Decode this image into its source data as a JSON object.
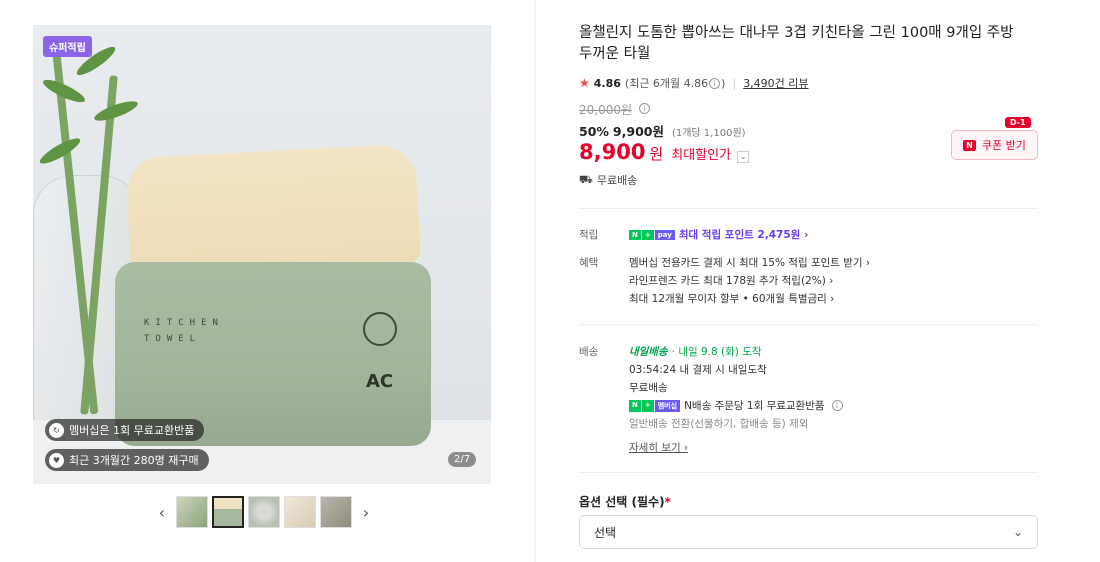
{
  "gallery": {
    "badge_top": "슈퍼적립",
    "pill_exchange": "멤버십은 1회 무료교환반품",
    "pill_repurchase": "최근 3개월간 280명 재구매",
    "counter": "2/7",
    "box_line1": "KITCHEN",
    "box_line2": "TOWEL",
    "box_logo": "AC",
    "prev_icon": "‹",
    "next_icon": "›"
  },
  "product": {
    "title": "올챌린지 도톰한 뽑아쓰는 대나무 3겹 키친타올 그린 100매 9개입 주방 두꺼운 타월",
    "rating": "4.86",
    "rating_recent": "(최근 6개월 4.86",
    "rating_recent_close": ")",
    "reviews": "3,490건 리뷰",
    "original_price": "20,000원",
    "discount_rate": "50%",
    "sale_price": "9,900원",
    "per_unit": "(1개당 1,100원)",
    "final_price": "8,900",
    "final_currency": "원",
    "final_label": "최대할인가",
    "free_shipping": "무료배송",
    "coupon_label": "쿠폰 받기",
    "coupon_dday": "D-1"
  },
  "benefits": {
    "points_label": "적립",
    "points_text": "최대 적립 포인트 2,475원 ›",
    "perks_label": "혜택",
    "perk1": "멤버십 전용카드 결제 시 최대 15% 적립 포인트 받기 ›",
    "perk2": "라인프렌즈 카드 최대 178원 추가 적립(2%) ›",
    "perk3": "최대 12개월 무이자 할부 • 60개월 특별금리 ›"
  },
  "shipping": {
    "label": "배송",
    "badge": "내일배송",
    "eta": "· 내일 9.8 (화) 도착",
    "countdown": "03:54:24  내 결제 시 내일도착",
    "fee": "무료배송",
    "n_exchange": "N배송 주문당 1회 무료교환반품",
    "normal": "일반배송 전환(선물하기, 합배송 등) 제외",
    "more": "자세히 보기 ›"
  },
  "options": {
    "label": "옵션 선택 (필수)",
    "required_mark": "*",
    "select_value": "선택"
  }
}
